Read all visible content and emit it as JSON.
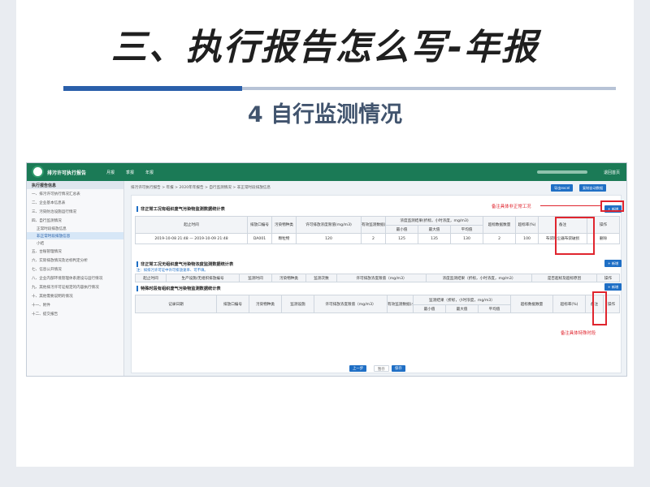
{
  "slide": {
    "title": "三、执行报告怎么写-年报",
    "subtitle": "4 自行监测情况"
  },
  "app": {
    "name": "排污许可执行报告",
    "nav": [
      "月报",
      "季报",
      "年报"
    ],
    "logout": "退回首页"
  },
  "sidebar": {
    "header": "执行报告信息",
    "items": [
      "一、排污许可执行情况汇总表",
      "二、企业基本信息表",
      "三、污染防治设施运行情况",
      "四、自行监测情况",
      "正常时段排放信息",
      "非正常时段排放信息",
      "小结",
      "五、台账管理情况",
      "六、实际排放情况及达标判定分析",
      "七、信息公开情况",
      "八、企业内部环境管理体系建设与运行情况",
      "九、其他排污许可证规定的内容执行情况",
      "十、其他需要说明的情况",
      "十一、附件",
      "十二、提交报告"
    ]
  },
  "breadcrumb": "排污许可执行报告 > 年报 > 2020年年报告 > 自行监测情况 > 非正常时段排放信息",
  "buttons": {
    "export_excel": "导出excel",
    "copy": "复制自动数据",
    "add": "+ 新增",
    "prev": "上一步",
    "save": "暂存",
    "next": "保存",
    "delete": "删除"
  },
  "table1": {
    "title": "非正常工况有组织废气污染物监测数据统计表",
    "headers": {
      "time": "起止时间",
      "outlet": "排放口编号",
      "pollutant": "污染物种类",
      "limit": "许可排放浓度限值(mg/m3)",
      "count": "有效监测数据(小时值)数量",
      "result": "浓度监测结果(折标，小时浓度，mg/m3)",
      "min": "最小值",
      "max": "最大值",
      "avg": "平均值",
      "exceed_count": "超标数据数量",
      "exceed_rate": "超标率(%)",
      "remark": "备注",
      "op": "操作"
    },
    "row": {
      "start": "2019-10-08 21:48",
      "sep": "—",
      "end": "2019-10-09 21:48",
      "outlet": "DA001",
      "pollutant": "颗粒物",
      "limit": "120",
      "count": "2",
      "min": "125",
      "max": "135",
      "avg": "130",
      "exceed_count": "2",
      "exceed_rate": "100",
      "remark": "布袋除尘器布袋破损"
    }
  },
  "table2": {
    "title": "非正常工况无组织废气污染物浓度监测数据统计表",
    "note": "注：如排污许可证中许可排放速率、可不填。",
    "headers": [
      "起止时间",
      "生产设施/无组织排放编号",
      "监测时间",
      "污染物种类",
      "监测次数",
      "许可排放浓度限值（mg/m3）",
      "浓度监测结果（折标，小时浓度，mg/m3）",
      "是否超标及超标原因",
      "操作"
    ]
  },
  "table3": {
    "title": "特殊时段有组织废气污染物监测数据统计表",
    "headers": {
      "date": "记录日期",
      "outlet": "排放口编号",
      "pollutant": "污染物种类",
      "facility": "监测设施",
      "limit": "许可排放浓度限值（mg/m3）",
      "count": "有效监测数据(小时值)数量",
      "result": "监测结果（折标，小时浓度，mg/m3）",
      "min": "最小值",
      "max": "最大值",
      "avg": "平均值",
      "exceed_count": "超标数据数量",
      "exceed_rate": "超标率(%)",
      "remark": "备注",
      "op": "操作"
    }
  },
  "annotations": {
    "top": "备注具体非正常工况",
    "bottom": "备注具体特殊时段"
  },
  "colors": {
    "header_green": "#1b7a56",
    "primary_blue": "#1f6fc5",
    "annotation_red": "#e0252e"
  }
}
